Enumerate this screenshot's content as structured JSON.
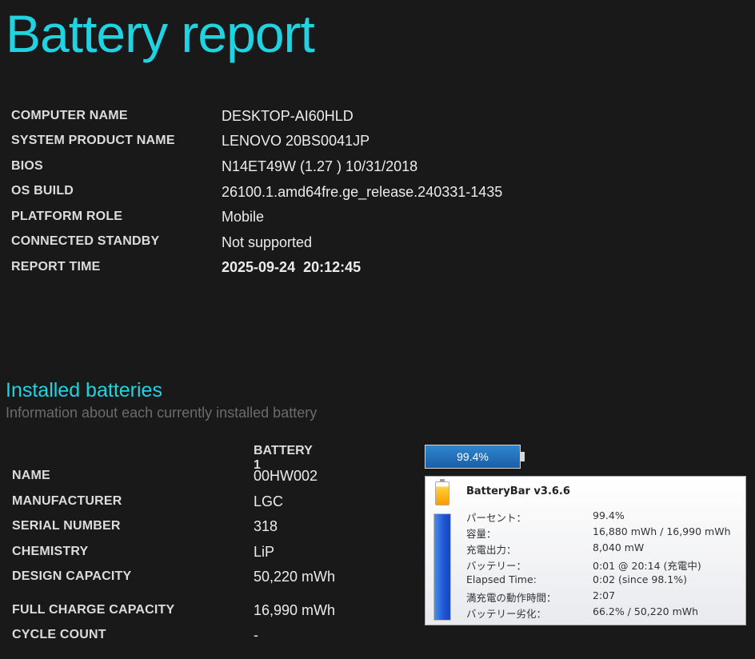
{
  "title": "Battery report",
  "info": [
    {
      "label": "COMPUTER NAME",
      "value": "DESKTOP-AI60HLD"
    },
    {
      "label": "SYSTEM PRODUCT NAME",
      "value": "LENOVO 20BS0041JP"
    },
    {
      "label": "BIOS",
      "value": "N14ET49W (1.27 ) 10/31/2018"
    },
    {
      "label": "OS BUILD",
      "value": "26100.1.amd64fre.ge_release.240331-1435"
    },
    {
      "label": "PLATFORM ROLE",
      "value": "Mobile"
    },
    {
      "label": "CONNECTED STANDBY",
      "value": "Not supported"
    },
    {
      "label": "REPORT TIME",
      "value": "2025-09-24  20:12:45"
    }
  ],
  "installed": {
    "title": "Installed batteries",
    "subtitle": "Information about each currently installed battery",
    "column_header": "BATTERY 1",
    "rows": [
      {
        "label": "NAME",
        "value": "00HW002"
      },
      {
        "label": "MANUFACTURER",
        "value": "LGC"
      },
      {
        "label": "SERIAL NUMBER",
        "value": "318"
      },
      {
        "label": "CHEMISTRY",
        "value": "LiP"
      },
      {
        "label": "DESIGN CAPACITY",
        "value": "50,220 mWh"
      },
      {
        "label": "FULL CHARGE CAPACITY",
        "value": "16,990 mWh"
      },
      {
        "label": "CYCLE COUNT",
        "value": "-"
      }
    ]
  },
  "batterybar": {
    "percent_label": "99.4%",
    "level_percent": 99.4,
    "app_name": "BatteryBar v3.6.6",
    "details": [
      {
        "key": "パーセント：",
        "value": "99.4%"
      },
      {
        "key": "容量：",
        "value": "16,880 mWh / 16,990 mWh"
      },
      {
        "key": "充電出力：",
        "value": "8,040 mW"
      },
      {
        "key": "バッテリー：",
        "value": "0:01 @ 20:14 (充電中)"
      },
      {
        "key": "Elapsed Time:",
        "value": "0:02 (since 98.1%)"
      },
      {
        "key": "満充電の動作時間：",
        "value": "2:07"
      },
      {
        "key": "バッテリー劣化：",
        "value": "66.2% / 50,220 mWh"
      }
    ]
  },
  "colors": {
    "accent": "#1fd3e2",
    "background": "#191919"
  }
}
